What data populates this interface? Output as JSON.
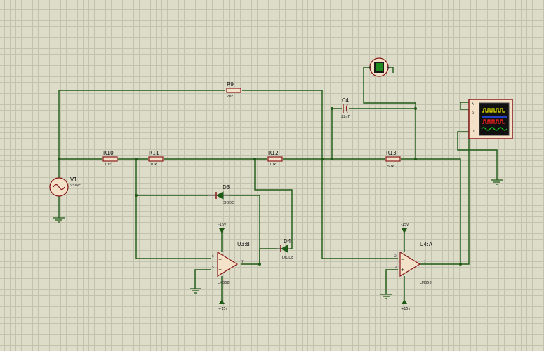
{
  "components": {
    "V1": {
      "ref": "V1",
      "type": "VSINE"
    },
    "R9": {
      "ref": "R9",
      "value": "20k"
    },
    "R10": {
      "ref": "R10",
      "value": "10k"
    },
    "R11": {
      "ref": "R11",
      "value": "10k"
    },
    "R12": {
      "ref": "R12",
      "value": "10k"
    },
    "R13": {
      "ref": "R13",
      "value": "50k"
    },
    "C4": {
      "ref": "C4",
      "value": "22nF"
    },
    "D3": {
      "ref": "D3",
      "type": "DIODE"
    },
    "D4": {
      "ref": "D4",
      "type": "DIODE"
    },
    "U3B": {
      "ref": "U3:B",
      "type": "LM358",
      "pins": [
        "6",
        "5",
        "7"
      ]
    },
    "U4A": {
      "ref": "U4:A",
      "type": "LM358",
      "pins": [
        "2",
        "3",
        "1"
      ]
    }
  },
  "supplies": {
    "neg": "-15v",
    "pos": "+15v"
  },
  "oscilloscope": {
    "channels": [
      "A",
      "B",
      "C",
      "D"
    ],
    "trace_colors": [
      "#e6e600",
      "#3050ff",
      "#ff2020",
      "#20d020"
    ]
  },
  "colors": {
    "wire": "#1e5a16",
    "component": "#8a1a1a",
    "background": "#dcdcc9"
  }
}
